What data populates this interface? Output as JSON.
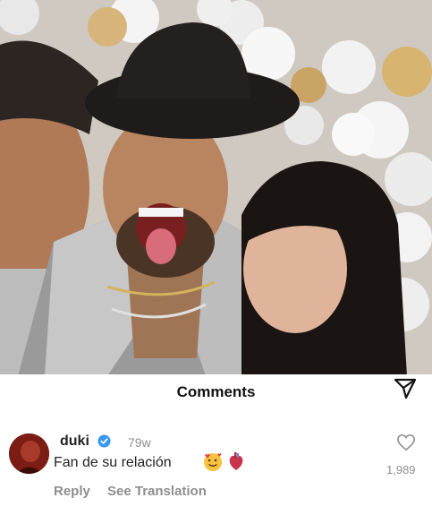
{
  "comments_section": {
    "title": "Comments",
    "share_icon": "send-icon"
  },
  "comment": {
    "username": "duki",
    "verified": true,
    "time": "79w",
    "text": "Fan de su relación",
    "emojis": [
      "smiling-face-with-hearts-emoji",
      "anatomical-heart-emoji"
    ],
    "like_count": "1,989",
    "reply_label": "Reply",
    "translation_label": "See Translation"
  },
  "colors": {
    "verified_blue": "#3897f0",
    "secondary_text": "#8e8e8e",
    "primary_text": "#222222"
  }
}
